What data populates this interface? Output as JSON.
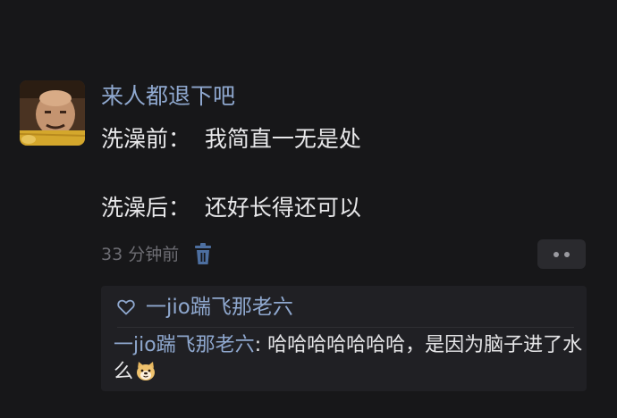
{
  "post": {
    "username": "来人都退下吧",
    "line1": "洗澡前：  我简直一无是处",
    "line2": "洗澡后：  还好长得还可以",
    "time": "33 分钟前"
  },
  "icons": {
    "avatar": "avatar-photo",
    "delete": "trash-icon",
    "more": "more-dots-icon",
    "like": "heart-outline-icon",
    "emoji": "doge-emoji-icon"
  },
  "reply_section": {
    "liker_name": "一jio踹飞那老六",
    "reply_author": "一jio踹飞那老六",
    "reply_separator": ": ",
    "reply_body": "哈哈哈哈哈哈哈，是因为脑子进了水么"
  },
  "colors": {
    "background": "#171719",
    "username": "#8fa8cf",
    "text": "#e8e8ea",
    "muted": "#6d6d73",
    "panel": "#202024"
  }
}
